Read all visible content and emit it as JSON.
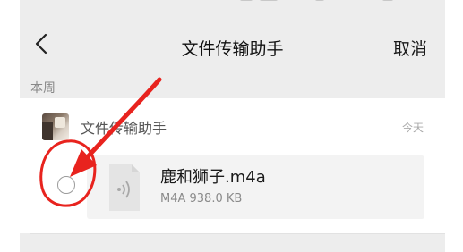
{
  "nav": {
    "back_icon": "chevron-left-icon",
    "title": "文件传输助手",
    "cancel_label": "取消"
  },
  "section": {
    "label": "本周"
  },
  "sender": {
    "name": "文件传输助手",
    "time": "今天",
    "avatar_icon": "avatar-photo"
  },
  "file": {
    "name": "鹿和狮子.m4a",
    "meta": "M4A 938.0 KB",
    "icon": "audio-file-icon",
    "selected": false
  },
  "annotation": {
    "color": "#e8231e",
    "shapes": [
      "hand-drawn-circle",
      "arrow"
    ]
  },
  "colors": {
    "page_background": "#ededed",
    "card_background": "#ffffff",
    "file_card": "#f3f3f3",
    "annotation": "#e8231e"
  }
}
